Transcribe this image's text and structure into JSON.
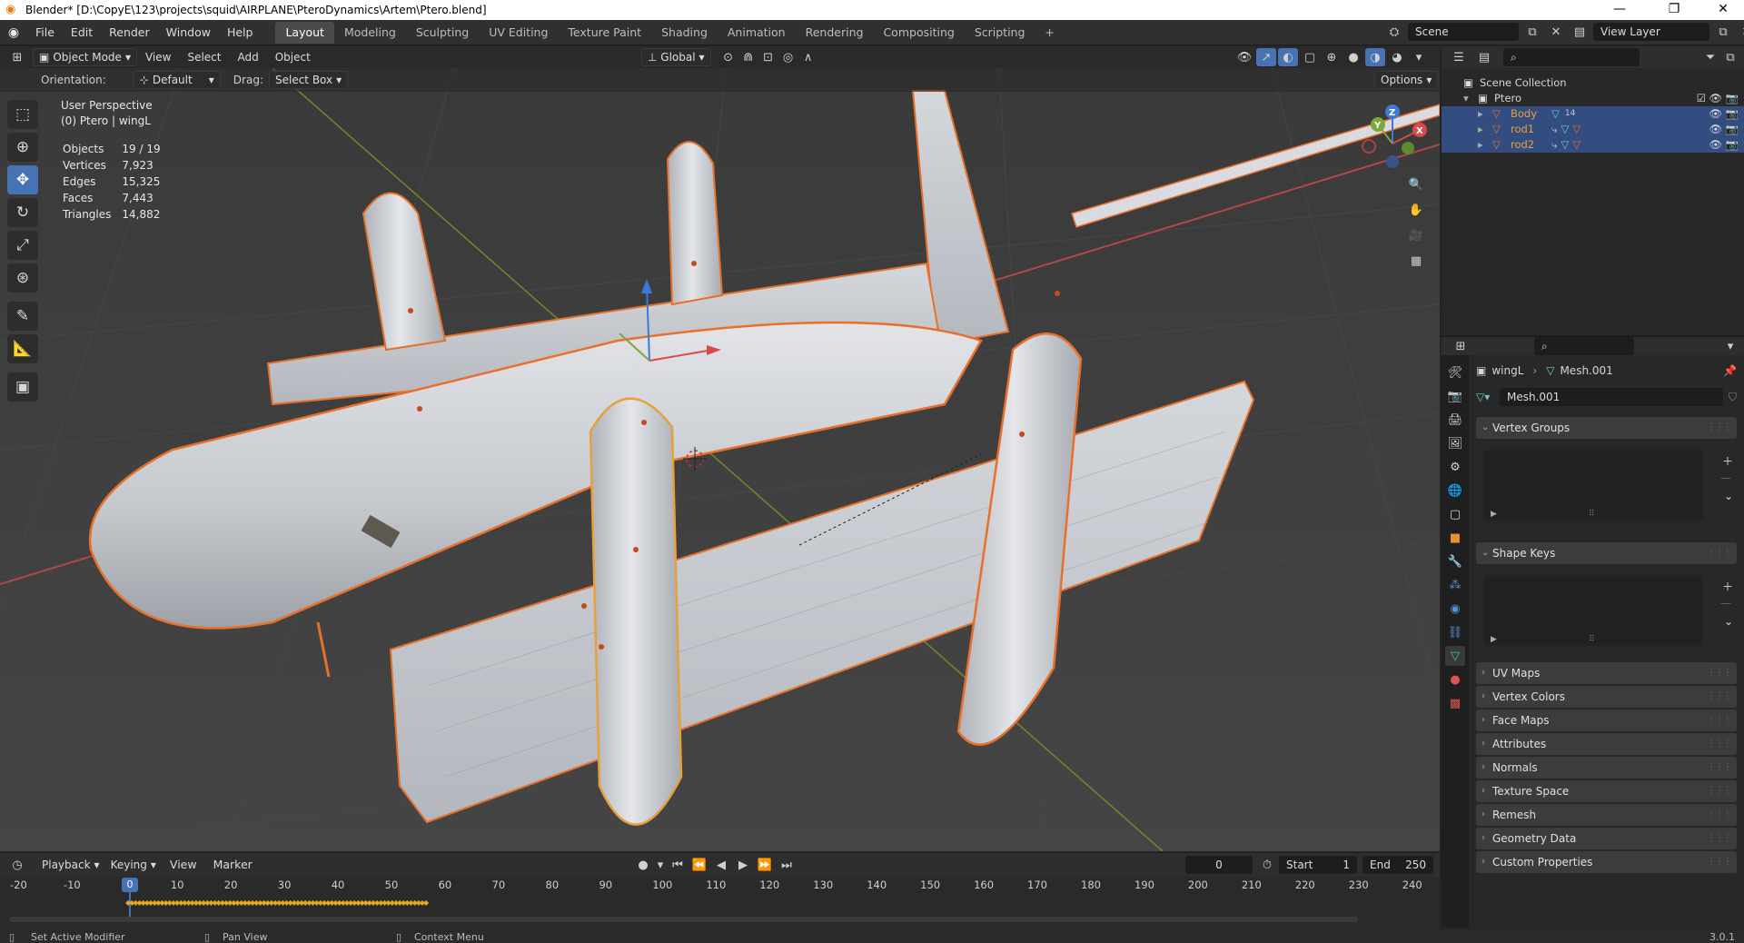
{
  "window": {
    "title": "Blender* [D:\\CopyE\\123\\projects\\squid\\AIRPLANE\\PteroDynamics\\Artem\\Ptero.blend]",
    "minimize": "—",
    "maximize": "❐",
    "close": "✕"
  },
  "menus": [
    "File",
    "Edit",
    "Render",
    "Window",
    "Help"
  ],
  "workspaces": [
    "Layout",
    "Modeling",
    "Sculpting",
    "UV Editing",
    "Texture Paint",
    "Shading",
    "Animation",
    "Rendering",
    "Compositing",
    "Scripting"
  ],
  "workspace_add": "+",
  "scene": {
    "label": "Scene"
  },
  "view_layer": {
    "label": "View Layer"
  },
  "viewport_header": {
    "mode": "Object Mode",
    "menus": [
      "View",
      "Select",
      "Add",
      "Object"
    ],
    "transform": "Global"
  },
  "viewport_sub": {
    "orientation_label": "Orientation:",
    "orientation_value": "Default",
    "drag_label": "Drag:",
    "drag_value": "Select Box",
    "options": "Options"
  },
  "viewport_overlay": {
    "view_name": "User Perspective",
    "object_info": "(0) Ptero | wingL",
    "stats": [
      {
        "label": "Objects",
        "value": "19 / 19"
      },
      {
        "label": "Vertices",
        "value": "7,923"
      },
      {
        "label": "Edges",
        "value": "15,325"
      },
      {
        "label": "Faces",
        "value": "7,443"
      },
      {
        "label": "Triangles",
        "value": "14,882"
      }
    ]
  },
  "gizmo": {
    "x": "X",
    "y": "Y",
    "z": "Z"
  },
  "outliner": {
    "scene_collection": "Scene Collection",
    "collection": "Ptero",
    "items": [
      {
        "name": "Body",
        "badge": "14"
      },
      {
        "name": "rod1"
      },
      {
        "name": "rod2"
      }
    ]
  },
  "properties": {
    "breadcrumb_object": "wingL",
    "breadcrumb_mesh": "Mesh.001",
    "mesh_name": "Mesh.001",
    "panels": [
      {
        "label": "Vertex Groups",
        "open": true
      },
      {
        "label": "Shape Keys",
        "open": true
      },
      {
        "label": "UV Maps",
        "open": false
      },
      {
        "label": "Vertex Colors",
        "open": false
      },
      {
        "label": "Face Maps",
        "open": false
      },
      {
        "label": "Attributes",
        "open": false
      },
      {
        "label": "Normals",
        "open": false
      },
      {
        "label": "Texture Space",
        "open": false
      },
      {
        "label": "Remesh",
        "open": false
      },
      {
        "label": "Geometry Data",
        "open": false
      },
      {
        "label": "Custom Properties",
        "open": false
      }
    ]
  },
  "timeline": {
    "menus": [
      "Playback",
      "Keying",
      "View",
      "Marker"
    ],
    "current_frame": "0",
    "start_label": "Start",
    "start_value": "1",
    "end_label": "End",
    "end_value": "250",
    "ticks": [
      "-20",
      "-10",
      "0",
      "10",
      "20",
      "30",
      "40",
      "50",
      "60",
      "70",
      "80",
      "90",
      "100",
      "110",
      "120",
      "130",
      "140",
      "150",
      "160",
      "170",
      "180",
      "190",
      "200",
      "210",
      "220",
      "230",
      "240"
    ]
  },
  "statusbar": {
    "hint1": "Set Active Modifier",
    "hint2": "Pan View",
    "hint3": "Context Menu",
    "version": "3.0.1"
  },
  "colors": {
    "selection_outline": "#e8702a",
    "active_blue": "#4772b3",
    "viewport_bg": "#3d3d3d",
    "panel_bg": "#282828"
  }
}
